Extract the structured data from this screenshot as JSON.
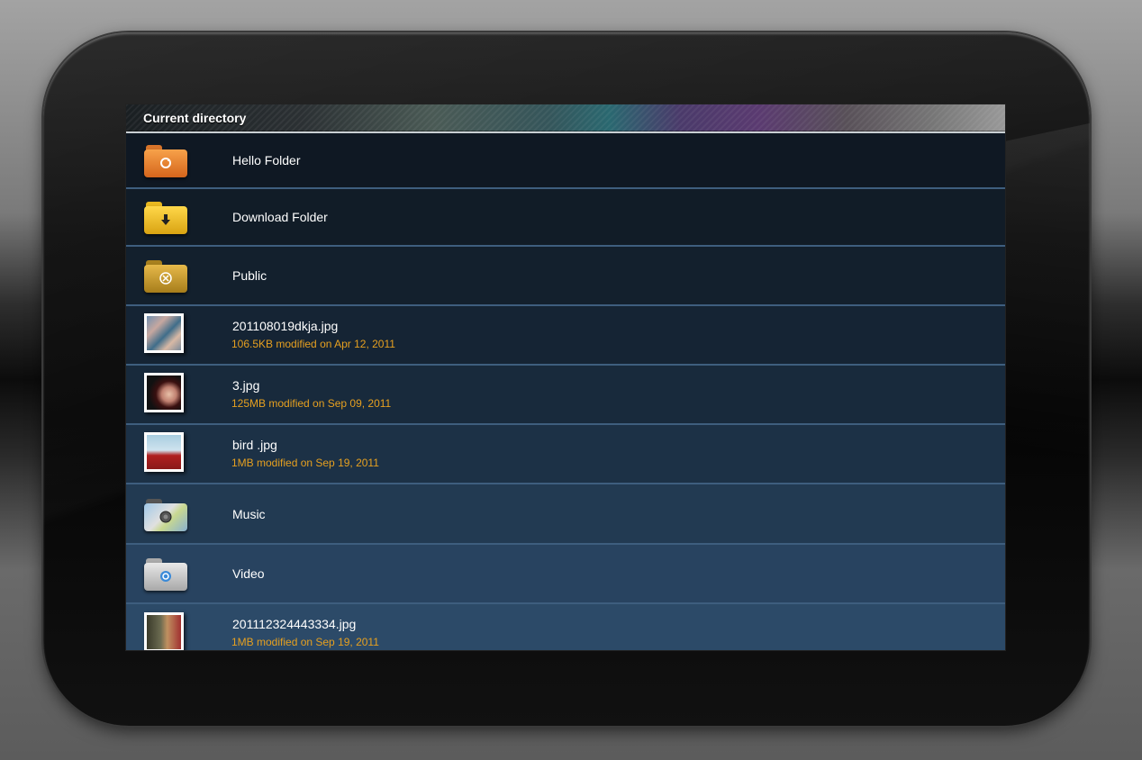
{
  "header": {
    "title": "Current directory"
  },
  "items": [
    {
      "name": "Hello Folder",
      "meta": "",
      "icon": "orange-sync-folder-icon"
    },
    {
      "name": "Download Folder",
      "meta": "",
      "icon": "yellow-download-folder-icon"
    },
    {
      "name": "Public",
      "meta": "",
      "icon": "gold-public-folder-icon"
    },
    {
      "name": "201108019dkja.jpg",
      "meta": "106.5KB modified on Apr 12, 2011",
      "icon": "photo-thumbnail-icon"
    },
    {
      "name": "3.jpg",
      "meta": "125MB modified on Sep 09, 2011",
      "icon": "photo-thumbnail-icon"
    },
    {
      "name": "bird .jpg",
      "meta": "1MB modified on Sep 19, 2011",
      "icon": "photo-thumbnail-icon"
    },
    {
      "name": "Music",
      "meta": "",
      "icon": "music-folder-icon"
    },
    {
      "name": "Video",
      "meta": "",
      "icon": "video-folder-icon"
    },
    {
      "name": "201112324443334.jpg",
      "meta": "1MB modified on Sep 19, 2011",
      "icon": "photo-thumbnail-icon"
    }
  ],
  "colors": {
    "meta_text": "#e6a020",
    "row_divider": "#3e5e7e"
  }
}
